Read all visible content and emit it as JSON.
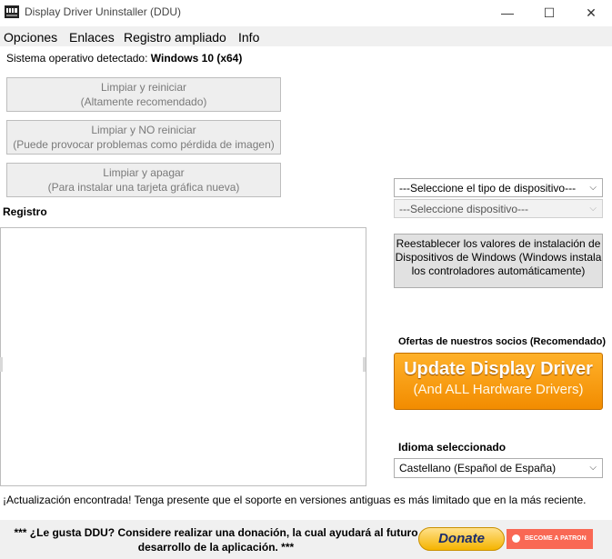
{
  "window": {
    "title": "Display Driver Uninstaller (DDU)",
    "icon": "ddu-app-icon",
    "controls": {
      "minimize": "—",
      "maximize": "☐",
      "close": "✕"
    }
  },
  "menu": {
    "items": [
      "Opciones",
      "Enlaces",
      "Registro ampliado",
      "Info"
    ]
  },
  "system": {
    "label": "Sistema operativo detectado: ",
    "value": "Windows 10 (x64)"
  },
  "actions": [
    {
      "line1": "Limpiar y reiniciar",
      "line2": "(Altamente recomendado)"
    },
    {
      "line1": "Limpiar y NO reiniciar",
      "line2": "(Puede provocar problemas como pérdida de imagen)"
    },
    {
      "line1": "Limpiar y apagar",
      "line2": "(Para instalar una tarjeta gráfica nueva)"
    }
  ],
  "log": {
    "label": "Registro"
  },
  "device_type_select": {
    "value": "---Seleccione el tipo de dispositivo---"
  },
  "device_select": {
    "value": "---Seleccione dispositivo---"
  },
  "reset_button": {
    "label": "Reestablecer los valores de instalación de Dispositivos de Windows (Windows instala los controladores automáticamente)"
  },
  "offers": {
    "label": "Ofertas de nuestros socios (Recomendado)",
    "update_line1": "Update Display Driver",
    "update_line2": "(And ALL Hardware Drivers)"
  },
  "language": {
    "label": "Idioma seleccionado",
    "value": "Castellano (Español de España)"
  },
  "update_message": "¡Actualización encontrada! Tenga presente que el soporte en versiones antiguas es más limitado que en la más reciente.",
  "footer": {
    "line1": "*** ¿Le gusta DDU? Considere realizar una donación, la cual ayudará al futuro",
    "line2": "desarrollo de la aplicación. ***",
    "donate_label": "Donate",
    "patron_label": "BECOME A PATRON"
  },
  "colors": {
    "update_button": "#f5a000",
    "patreon": "#f96854",
    "menubar": "#f0f0f0"
  }
}
